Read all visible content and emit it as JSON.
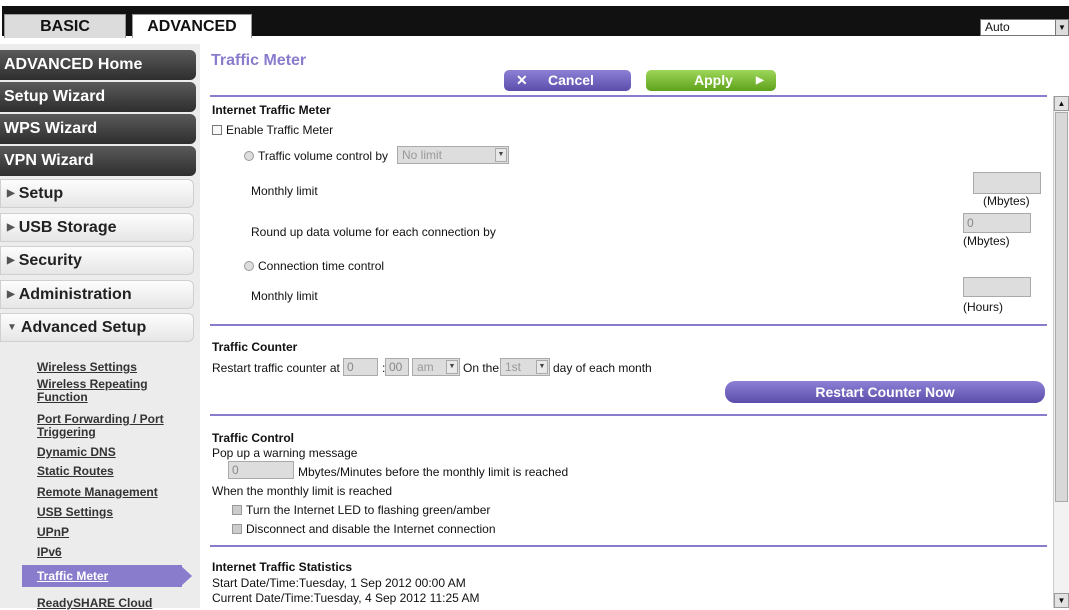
{
  "tabs": {
    "basic": "BASIC",
    "advanced": "ADVANCED"
  },
  "language": {
    "value": "Auto"
  },
  "sidebar": {
    "dark": [
      "ADVANCED Home",
      "Setup Wizard",
      "WPS Wizard",
      "VPN Wizard"
    ],
    "light": [
      "Setup",
      "USB Storage",
      "Security",
      "Administration",
      "Advanced Setup"
    ],
    "sub": [
      "Wireless Settings",
      "Wireless Repeating Function",
      "Port Forwarding / Port Triggering",
      "Dynamic DNS",
      "Static Routes",
      "Remote Management",
      "USB Settings",
      "UPnP",
      "IPv6",
      "Traffic Meter",
      "ReadySHARE Cloud"
    ]
  },
  "page": {
    "title": "Traffic Meter",
    "cancel": "Cancel",
    "apply": "Apply"
  },
  "meter": {
    "heading": "Internet Traffic Meter",
    "enable": "Enable Traffic Meter",
    "volume_label": "Traffic volume control by",
    "volume_select": "No limit",
    "monthly_limit": "Monthly limit",
    "mbytes": "(Mbytes)",
    "roundup": "Round up data volume for each connection by",
    "roundup_value": "0",
    "conn_time": "Connection time control",
    "hours": "(Hours)"
  },
  "counter": {
    "heading": "Traffic Counter",
    "restart_at": "Restart traffic counter at",
    "hour": "0",
    "colon": ":",
    "minute": "00",
    "ampm": "am",
    "on_the": "On the",
    "day": "1st",
    "day_suffix": "day of each month",
    "restart_now": "Restart Counter Now"
  },
  "control": {
    "heading": "Traffic Control",
    "popup": "Pop up a warning message",
    "warn_value": "0",
    "warn_text": "Mbytes/Minutes before the monthly limit is reached",
    "when": "When the monthly limit is reached",
    "led": "Turn the Internet LED to flashing green/amber",
    "disconnect": "Disconnect and disable the Internet connection"
  },
  "stats": {
    "heading": "Internet Traffic Statistics",
    "start": "Start Date/Time:Tuesday, 1 Sep 2012 00:00 AM",
    "current": "Current Date/Time:Tuesday, 4 Sep 2012 11:25 AM"
  }
}
